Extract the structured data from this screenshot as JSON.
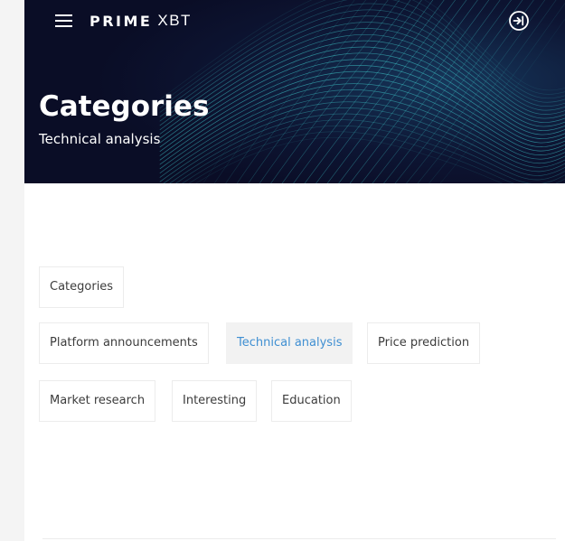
{
  "header": {
    "menu_icon": "hamburger-menu-icon",
    "logo_bold": "PRIME",
    "logo_light": "XBT",
    "login_icon": "login-icon"
  },
  "hero": {
    "title": "Categories",
    "subtitle": "Technical analysis"
  },
  "categories": {
    "root_label": "Categories",
    "items": [
      {
        "label": "Platform announcements",
        "active": false
      },
      {
        "label": "Technical analysis",
        "active": true
      },
      {
        "label": "Price prediction",
        "active": false
      },
      {
        "label": "Market research",
        "active": false
      },
      {
        "label": "Interesting",
        "active": false
      },
      {
        "label": "Education",
        "active": false
      }
    ]
  },
  "colors": {
    "hero_background": "#0b0f2a",
    "hero_lines": "#3fc6c9",
    "active_text": "#3f8fd2",
    "active_background": "#f2f2f2",
    "chip_border": "#ececec",
    "chip_text": "#3c3c3c"
  }
}
